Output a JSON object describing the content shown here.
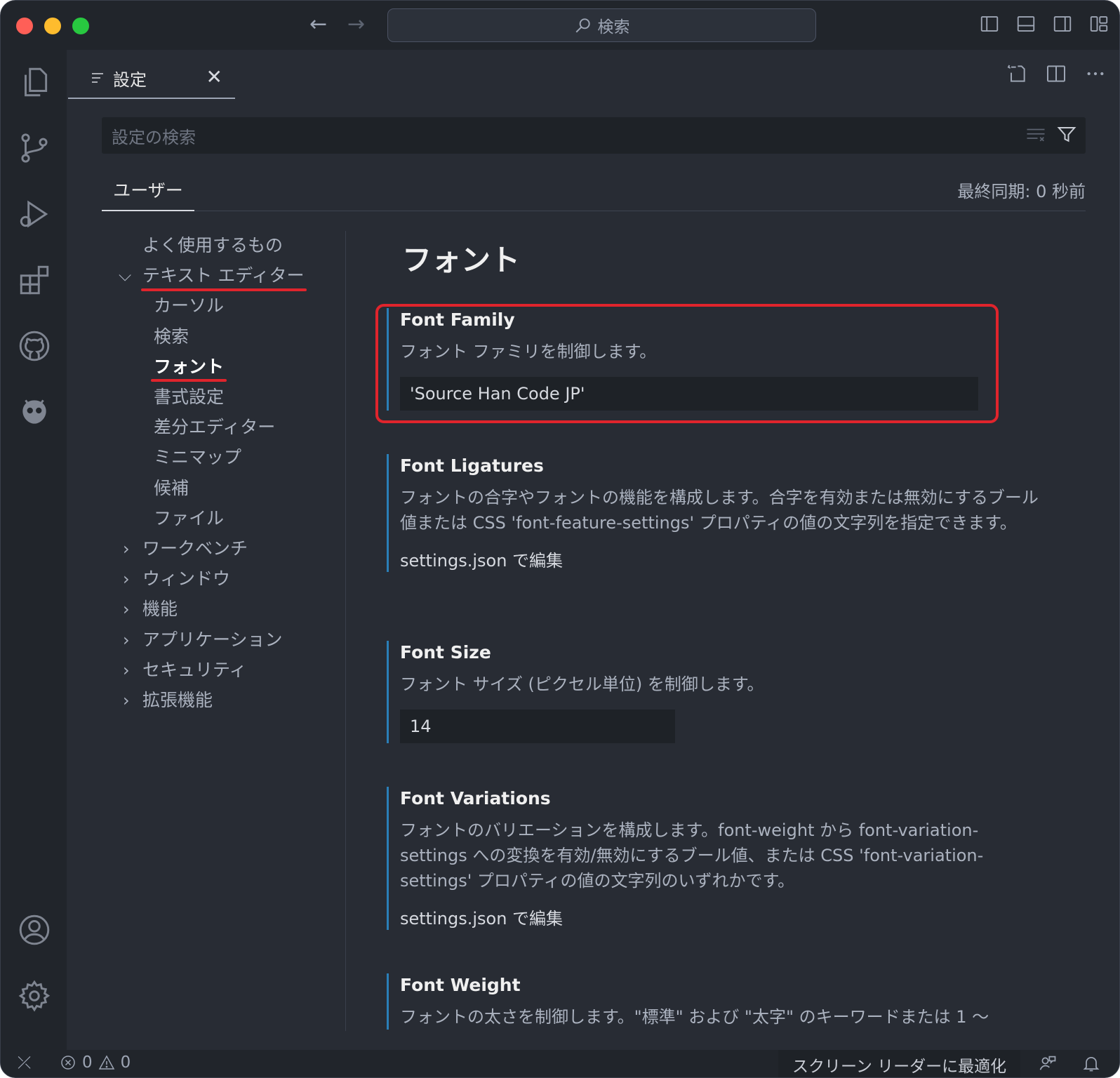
{
  "titlebar": {
    "search_text": "検索",
    "icons": [
      "back-arrow-icon",
      "forward-arrow-icon",
      "search-icon",
      "toggle-primary-sidebar-icon",
      "toggle-panel-icon",
      "toggle-secondary-sidebar-icon",
      "customize-layout-icon"
    ]
  },
  "activity_bar": {
    "items": [
      "explorer-icon",
      "source-control-icon",
      "run-debug-icon",
      "extensions-icon",
      "github-icon",
      "platformio-icon",
      "accounts-icon",
      "manage-gear-icon"
    ]
  },
  "tab": {
    "label": "設定",
    "close": "✕"
  },
  "settings_search": {
    "placeholder": "設定の検索"
  },
  "scope": {
    "user_tab": "ユーザー",
    "last_sync": "最終同期: 0 秒前"
  },
  "toc": {
    "items": [
      {
        "label": "よく使用するもの",
        "expanded": null
      },
      {
        "label": "テキスト エディター",
        "expanded": true
      },
      {
        "label": "カーソル",
        "expanded": null
      },
      {
        "label": "検索",
        "expanded": null
      },
      {
        "label": "フォント",
        "expanded": null,
        "active": true
      },
      {
        "label": "書式設定",
        "expanded": null
      },
      {
        "label": "差分エディター",
        "expanded": null
      },
      {
        "label": "ミニマップ",
        "expanded": null
      },
      {
        "label": "候補",
        "expanded": null
      },
      {
        "label": "ファイル",
        "expanded": null
      },
      {
        "label": "ワークベンチ",
        "expanded": false
      },
      {
        "label": "ウィンドウ",
        "expanded": false
      },
      {
        "label": "機能",
        "expanded": false
      },
      {
        "label": "アプリケーション",
        "expanded": false
      },
      {
        "label": "セキュリティ",
        "expanded": false
      },
      {
        "label": "拡張機能",
        "expanded": false
      }
    ],
    "chevron_down": "⌵",
    "chevron_right": "›"
  },
  "content": {
    "section_title": "フォント",
    "settings": [
      {
        "name": "Font Family",
        "desc": "フォント ファミリを制御します。",
        "value": "'Source Han Code JP'"
      },
      {
        "name": "Font Ligatures",
        "desc": "フォントの合字やフォントの機能を構成します。合字を有効または無効にするブール値または CSS 'font-feature-settings' プロパティの値の文字列を指定できます。",
        "link": "settings.json で編集"
      },
      {
        "name": "Font Size",
        "desc": "フォント サイズ (ピクセル単位) を制御します。",
        "value": "14"
      },
      {
        "name": "Font Variations",
        "desc": "フォントのバリエーションを構成します。font-weight から font-variation-settings への変換を有効/無効にするブール値、または CSS 'font-variation-settings' プロパティの値の文字列のいずれかです。",
        "link": "settings.json で編集"
      },
      {
        "name": "Font Weight",
        "desc": "フォントの太さを制御します。\"標準\" および \"太字\" のキーワードまたは 1 ～"
      }
    ]
  },
  "statusbar": {
    "errors": "0",
    "warnings": "0",
    "screen_reader": "スクリーン リーダーに最適化"
  },
  "colors": {
    "background": "#282c34",
    "chrome": "#21252b",
    "accent_border": "#2a7fb8",
    "annotation_red": "#e0242c"
  }
}
